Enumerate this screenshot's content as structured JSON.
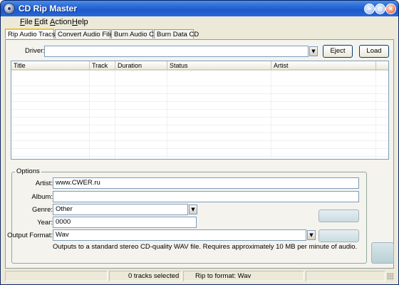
{
  "window": {
    "title": "CD Rip Master"
  },
  "menu": [
    "File",
    "Edit",
    "Action",
    "Help"
  ],
  "tabs": [
    "Rip Audio Tracsk",
    "Convert Audio Files",
    "Burn Audio CD",
    "Burn Data CD"
  ],
  "driver": {
    "label": "Driver:",
    "value": ""
  },
  "buttons": {
    "eject": "Eject",
    "load": "Load"
  },
  "track_list": {
    "columns": [
      "Title",
      "Track",
      "Duration",
      "Status",
      "Artist"
    ],
    "rows": []
  },
  "options": {
    "legend": "Options",
    "artist_label": "Artist:",
    "artist_value": "www.CWER.ru",
    "album_label": "Album:",
    "album_value": "",
    "genre_label": "Genre:",
    "genre_value": "Other",
    "year_label": "Year:",
    "year_value": "0000",
    "format_label": "Output Format:",
    "format_value": "Wav",
    "format_description": "Outputs to a standard stereo CD-quality WAV file.  Requires approximately 10 MB per minute of audio."
  },
  "status": {
    "tracks_selected": "0 tracks selected",
    "rip_format": "Rip to format: Wav"
  }
}
